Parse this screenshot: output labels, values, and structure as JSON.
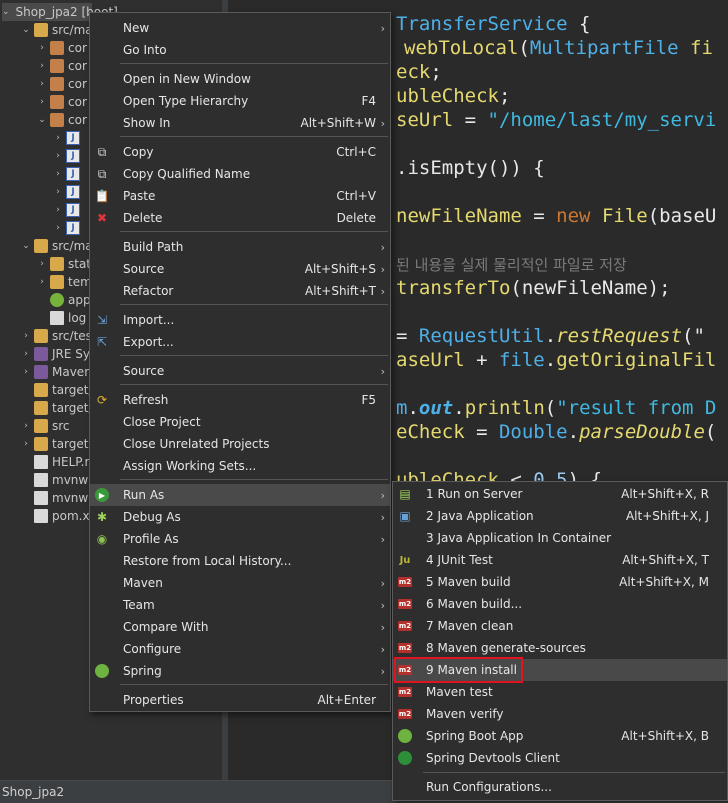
{
  "tree": {
    "rows": [
      {
        "arrow": "⌄",
        "indent": 2,
        "icon": "proj",
        "label": "Shop_jpa2 [boot]"
      },
      {
        "arrow": "⌄",
        "indent": 20,
        "icon": "folder",
        "label": "src/ma"
      },
      {
        "arrow": "›",
        "indent": 36,
        "icon": "pkg",
        "label": "cor"
      },
      {
        "arrow": "›",
        "indent": 36,
        "icon": "pkg",
        "label": "cor"
      },
      {
        "arrow": "›",
        "indent": 36,
        "icon": "pkg",
        "label": "cor"
      },
      {
        "arrow": "›",
        "indent": 36,
        "icon": "pkg",
        "label": "cor"
      },
      {
        "arrow": "⌄",
        "indent": 36,
        "icon": "pkg",
        "label": "cor"
      },
      {
        "arrow": "›",
        "indent": 52,
        "icon": "java",
        "label": ""
      },
      {
        "arrow": "›",
        "indent": 52,
        "icon": "java",
        "label": ""
      },
      {
        "arrow": "›",
        "indent": 52,
        "icon": "java",
        "label": ""
      },
      {
        "arrow": "›",
        "indent": 52,
        "icon": "java",
        "label": ""
      },
      {
        "arrow": "›",
        "indent": 52,
        "icon": "java",
        "label": ""
      },
      {
        "arrow": "›",
        "indent": 52,
        "icon": "java",
        "label": ""
      },
      {
        "arrow": "⌄",
        "indent": 20,
        "icon": "folder",
        "label": "src/ma"
      },
      {
        "arrow": "›",
        "indent": 36,
        "icon": "folder",
        "label": "stat"
      },
      {
        "arrow": "›",
        "indent": 36,
        "icon": "folder",
        "label": "tem"
      },
      {
        "arrow": "",
        "indent": 36,
        "icon": "leaf",
        "label": "app"
      },
      {
        "arrow": "",
        "indent": 36,
        "icon": "file",
        "label": "log"
      },
      {
        "arrow": "›",
        "indent": 20,
        "icon": "folder",
        "label": "src/tes"
      },
      {
        "arrow": "›",
        "indent": 20,
        "icon": "lib",
        "label": "JRE Sy"
      },
      {
        "arrow": "›",
        "indent": 20,
        "icon": "lib",
        "label": "Maven"
      },
      {
        "arrow": "",
        "indent": 20,
        "icon": "folder",
        "label": "target/"
      },
      {
        "arrow": "",
        "indent": 20,
        "icon": "folder",
        "label": "target/"
      },
      {
        "arrow": "›",
        "indent": 20,
        "icon": "folder",
        "label": "src"
      },
      {
        "arrow": "›",
        "indent": 20,
        "icon": "folder",
        "label": "target"
      },
      {
        "arrow": "",
        "indent": 20,
        "icon": "file",
        "label": "HELP.r"
      },
      {
        "arrow": "",
        "indent": 20,
        "icon": "file",
        "label": "mvnw"
      },
      {
        "arrow": "",
        "indent": 20,
        "icon": "file",
        "label": "mvnw"
      },
      {
        "arrow": "",
        "indent": 20,
        "icon": "file",
        "label": "pom.x"
      }
    ]
  },
  "editor": {
    "lines": [
      [
        {
          "c": "c-ty",
          "t": "TransferService "
        },
        {
          "c": "c-pl",
          "t": "{"
        }
      ],
      [
        {
          "c": "c-fn",
          "t": "webToLocal"
        },
        {
          "c": "c-pl",
          "t": "("
        },
        {
          "c": "c-ty",
          "t": "MultipartFile "
        },
        {
          "c": "c-fn",
          "t": "fi"
        }
      ],
      [
        {
          "c": "c-fn",
          "t": "eck"
        },
        {
          "c": "c-pl",
          "t": ";"
        }
      ],
      [
        {
          "c": "c-fn",
          "t": "ubleCheck"
        },
        {
          "c": "c-pl",
          "t": ";"
        }
      ],
      [
        {
          "c": "c-fn",
          "t": "seUrl "
        },
        {
          "c": "c-pl",
          "t": "= "
        },
        {
          "c": "c-st",
          "t": "\"/home/last/my_servi"
        }
      ],
      [
        {
          "c": "c-pl",
          "t": ""
        }
      ],
      [
        {
          "c": "c-pl",
          "t": ".isEmpty()) {"
        }
      ],
      [
        {
          "c": "c-pl",
          "t": ""
        }
      ],
      [
        {
          "c": "c-fn",
          "t": "newFileName "
        },
        {
          "c": "c-pl",
          "t": "= "
        },
        {
          "c": "c-kw",
          "t": "new "
        },
        {
          "c": "c-fn",
          "t": "File"
        },
        {
          "c": "c-pl",
          "t": "(baseU"
        }
      ],
      [
        {
          "c": "c-pl",
          "t": ""
        }
      ],
      [
        {
          "c": "c-cm",
          "t": "된 내용을 실제 물리적인 파일로 저장"
        }
      ],
      [
        {
          "c": "c-fn",
          "t": "transferTo"
        },
        {
          "c": "c-pl",
          "t": "(newFileName);"
        }
      ],
      [
        {
          "c": "c-pl",
          "t": ""
        }
      ],
      [
        {
          "c": "c-pl",
          "t": "= "
        },
        {
          "c": "c-ty",
          "t": "RequestUtil"
        },
        {
          "c": "c-pl",
          "t": "."
        },
        {
          "c": "c-it",
          "t": "restRequest"
        },
        {
          "c": "c-pl",
          "t": "(\""
        }
      ],
      [
        {
          "c": "c-fn",
          "t": "aseUrl "
        },
        {
          "c": "c-pl",
          "t": "+ "
        },
        {
          "c": "c-ty",
          "t": "file"
        },
        {
          "c": "c-pl",
          "t": "."
        },
        {
          "c": "c-fn",
          "t": "getOriginalFil"
        }
      ],
      [
        {
          "c": "c-pl",
          "t": ""
        }
      ],
      [
        {
          "c": "c-ty",
          "t": "m"
        },
        {
          "c": "c-pl",
          "t": "."
        },
        {
          "c": "c-fd",
          "t": "out"
        },
        {
          "c": "c-pl",
          "t": "."
        },
        {
          "c": "c-fn",
          "t": "println"
        },
        {
          "c": "c-pl",
          "t": "("
        },
        {
          "c": "c-st",
          "t": "\"result from D"
        }
      ],
      [
        {
          "c": "c-fn",
          "t": "eCheck "
        },
        {
          "c": "c-pl",
          "t": "= "
        },
        {
          "c": "c-ty",
          "t": "Double"
        },
        {
          "c": "c-pl",
          "t": "."
        },
        {
          "c": "c-it",
          "t": "parseDouble"
        },
        {
          "c": "c-pl",
          "t": "("
        }
      ],
      [
        {
          "c": "c-pl",
          "t": ""
        }
      ],
      [
        {
          "c": "c-fn",
          "t": "ubleCheck "
        },
        {
          "c": "c-pl",
          "t": "< "
        },
        {
          "c": "c-nu",
          "t": "0.5"
        },
        {
          "c": "c-pl",
          "t": ") {"
        }
      ]
    ]
  },
  "context_menu": {
    "items": [
      {
        "label": "New",
        "shortcut": "",
        "submenu": true,
        "icon": ""
      },
      {
        "label": "Go Into",
        "shortcut": "",
        "submenu": false,
        "icon": ""
      },
      {
        "sep": true
      },
      {
        "label": "Open in New Window",
        "shortcut": "",
        "submenu": false,
        "icon": ""
      },
      {
        "label": "Open Type Hierarchy",
        "shortcut": "F4",
        "submenu": false,
        "icon": ""
      },
      {
        "label": "Show In",
        "shortcut": "Alt+Shift+W",
        "submenu": true,
        "icon": ""
      },
      {
        "sep": true
      },
      {
        "label": "Copy",
        "shortcut": "Ctrl+C",
        "submenu": false,
        "icon": "copy-icon"
      },
      {
        "label": "Copy Qualified Name",
        "shortcut": "",
        "submenu": false,
        "icon": "copy-qualified-icon"
      },
      {
        "label": "Paste",
        "shortcut": "Ctrl+V",
        "submenu": false,
        "icon": "paste-icon"
      },
      {
        "label": "Delete",
        "shortcut": "Delete",
        "submenu": false,
        "icon": "delete-icon"
      },
      {
        "sep": true
      },
      {
        "label": "Build Path",
        "shortcut": "",
        "submenu": true,
        "icon": ""
      },
      {
        "label": "Source",
        "shortcut": "Alt+Shift+S",
        "submenu": true,
        "icon": ""
      },
      {
        "label": "Refactor",
        "shortcut": "Alt+Shift+T",
        "submenu": true,
        "icon": ""
      },
      {
        "sep": true
      },
      {
        "label": "Import...",
        "shortcut": "",
        "submenu": false,
        "icon": "import-icon"
      },
      {
        "label": "Export...",
        "shortcut": "",
        "submenu": false,
        "icon": "export-icon"
      },
      {
        "sep": true
      },
      {
        "label": "Source",
        "shortcut": "",
        "submenu": true,
        "icon": ""
      },
      {
        "sep": true
      },
      {
        "label": "Refresh",
        "shortcut": "F5",
        "submenu": false,
        "icon": "refresh-icon"
      },
      {
        "label": "Close Project",
        "shortcut": "",
        "submenu": false,
        "icon": ""
      },
      {
        "label": "Close Unrelated Projects",
        "shortcut": "",
        "submenu": false,
        "icon": ""
      },
      {
        "label": "Assign Working Sets...",
        "shortcut": "",
        "submenu": false,
        "icon": ""
      },
      {
        "sep": true
      },
      {
        "label": "Run As",
        "shortcut": "",
        "submenu": true,
        "icon": "run-icon",
        "active": true
      },
      {
        "label": "Debug As",
        "shortcut": "",
        "submenu": true,
        "icon": "debug-icon"
      },
      {
        "label": "Profile As",
        "shortcut": "",
        "submenu": true,
        "icon": "profile-icon"
      },
      {
        "label": "Restore from Local History...",
        "shortcut": "",
        "submenu": false,
        "icon": ""
      },
      {
        "label": "Maven",
        "shortcut": "",
        "submenu": true,
        "icon": ""
      },
      {
        "label": "Team",
        "shortcut": "",
        "submenu": true,
        "icon": ""
      },
      {
        "label": "Compare With",
        "shortcut": "",
        "submenu": true,
        "icon": ""
      },
      {
        "label": "Configure",
        "shortcut": "",
        "submenu": true,
        "icon": ""
      },
      {
        "label": "Spring",
        "shortcut": "",
        "submenu": true,
        "icon": "spring-icon"
      },
      {
        "sep": true
      },
      {
        "label": "Properties",
        "shortcut": "Alt+Enter",
        "submenu": false,
        "icon": ""
      }
    ]
  },
  "run_as_menu": {
    "items": [
      {
        "label": "1 Run on Server",
        "shortcut": "Alt+Shift+X, R",
        "icon": "server-icon"
      },
      {
        "label": "2 Java Application",
        "shortcut": "Alt+Shift+X, J",
        "icon": "java-app-icon"
      },
      {
        "label": "3 Java Application In Container",
        "shortcut": "",
        "icon": "container-icon"
      },
      {
        "label": "4 JUnit Test",
        "shortcut": "Alt+Shift+X, T",
        "icon": "junit-icon"
      },
      {
        "label": "5 Maven build",
        "shortcut": "Alt+Shift+X, M",
        "icon": "maven-icon"
      },
      {
        "label": "6 Maven build...",
        "shortcut": "",
        "icon": "maven-icon"
      },
      {
        "label": "7 Maven clean",
        "shortcut": "",
        "icon": "maven-icon"
      },
      {
        "label": "8 Maven generate-sources",
        "shortcut": "",
        "icon": "maven-icon"
      },
      {
        "label": "9 Maven install",
        "shortcut": "",
        "icon": "maven-icon",
        "selected": true
      },
      {
        "label": "Maven test",
        "shortcut": "",
        "icon": "maven-icon"
      },
      {
        "label": "Maven verify",
        "shortcut": "",
        "icon": "maven-icon"
      },
      {
        "label": "Spring Boot App",
        "shortcut": "Alt+Shift+X, B",
        "icon": "spring-boot-icon"
      },
      {
        "label": "Spring Devtools Client",
        "shortcut": "",
        "icon": "spring-devtools-icon"
      },
      {
        "sep": true
      },
      {
        "label": "Run Configurations...",
        "shortcut": "",
        "icon": ""
      }
    ]
  },
  "status_bar": {
    "text": "Shop_jpa2"
  },
  "colors": {
    "highlight_box": "#e0141e",
    "menu_bg": "#2e2e2e",
    "editor_bg": "#2a2a2a"
  }
}
